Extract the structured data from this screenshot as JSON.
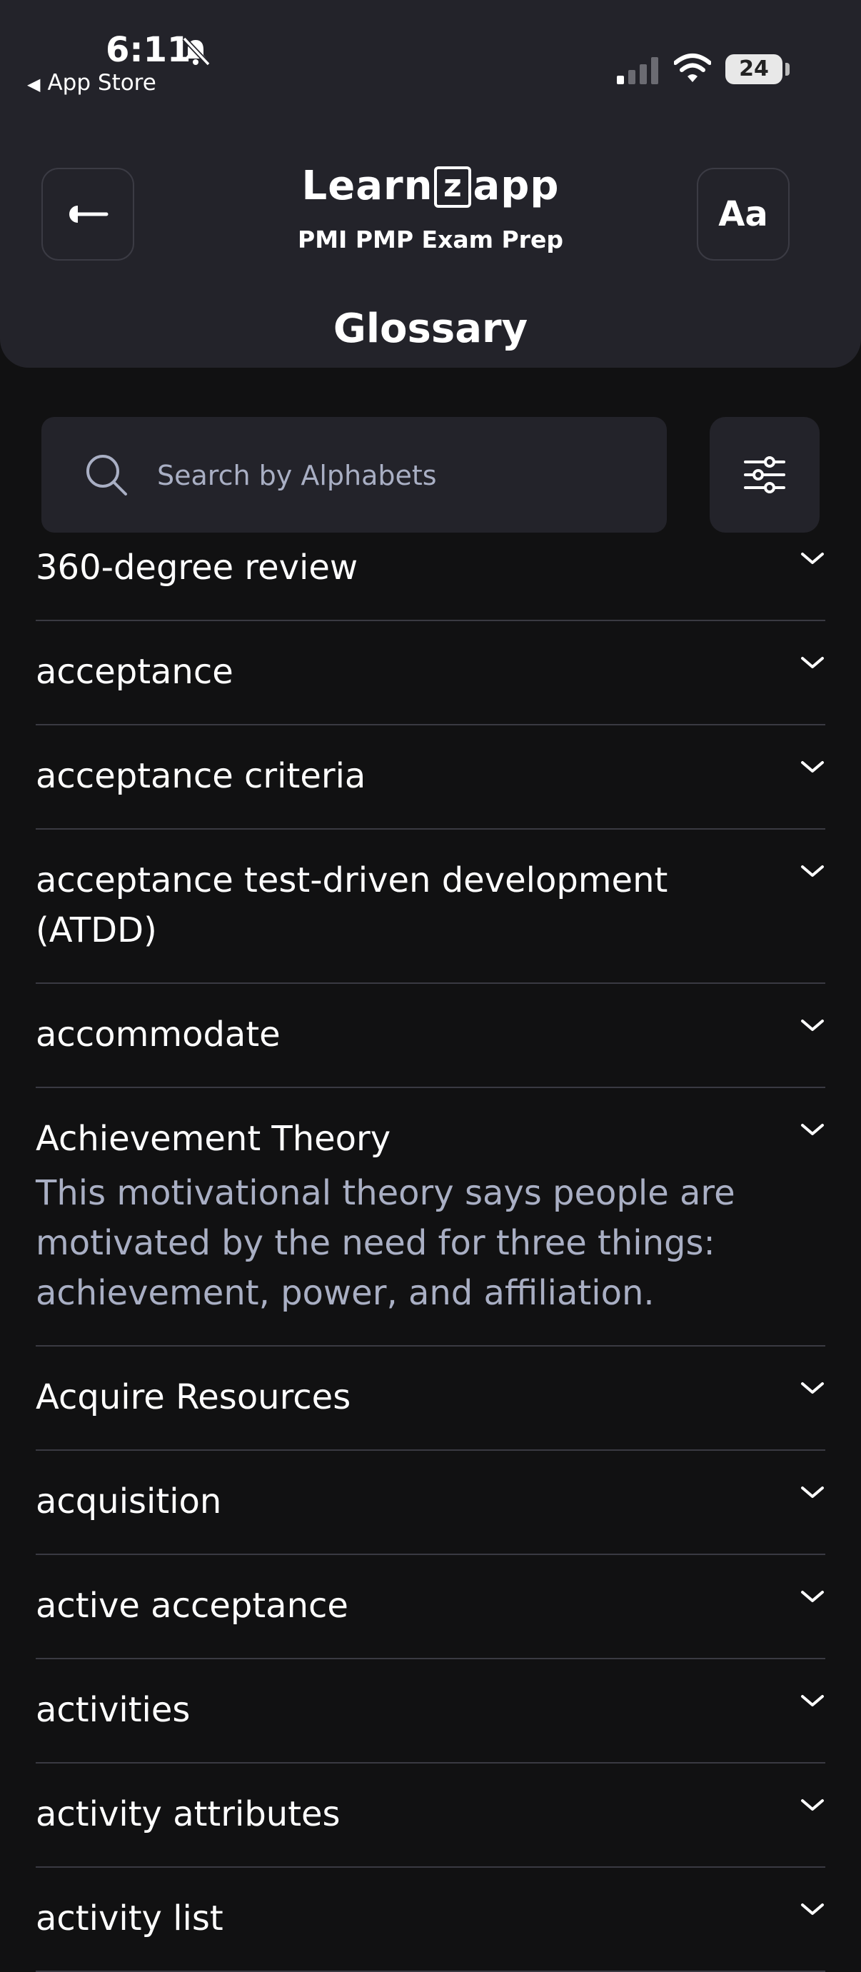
{
  "status_bar": {
    "time": "6:11",
    "back_app_label": "App Store",
    "battery_level": "24"
  },
  "header": {
    "logo_text_before": "Learn",
    "logo_text_z": "z",
    "logo_text_after": "app",
    "subtitle": "PMI PMP Exam Prep",
    "font_button_label": "Aa",
    "title": "Glossary"
  },
  "search": {
    "placeholder": "Search by Alphabets"
  },
  "glossary": [
    {
      "term": "360-degree review",
      "definition": ""
    },
    {
      "term": "acceptance",
      "definition": ""
    },
    {
      "term": "acceptance criteria",
      "definition": ""
    },
    {
      "term": "acceptance test-driven development (ATDD)",
      "definition": ""
    },
    {
      "term": "accommodate",
      "definition": ""
    },
    {
      "term": "Achievement Theory",
      "definition": "This motivational theory says people are motivated by the need for three things: achievement, power, and affiliation."
    },
    {
      "term": "Acquire Resources",
      "definition": ""
    },
    {
      "term": "acquisition",
      "definition": ""
    },
    {
      "term": "active acceptance",
      "definition": ""
    },
    {
      "term": "activities",
      "definition": ""
    },
    {
      "term": "activity attributes",
      "definition": ""
    },
    {
      "term": "activity list",
      "definition": ""
    }
  ],
  "icons": {
    "back": "arrow-left-icon",
    "search": "search-icon",
    "filter": "sliders-icon",
    "expand": "chevron-down-icon"
  }
}
